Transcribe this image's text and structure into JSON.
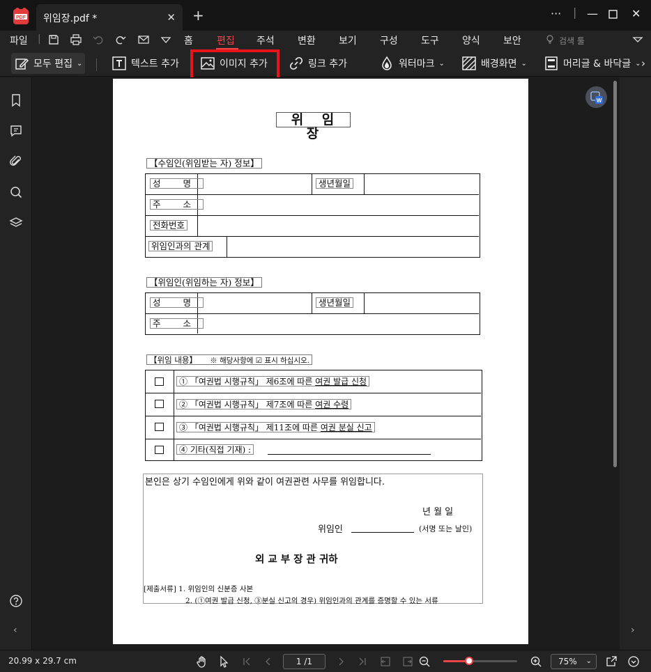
{
  "titlebar": {
    "tab_title": "위임장.pdf *",
    "close_glyph": "✕",
    "new_tab_glyph": "+",
    "more_glyph": "···",
    "minimize_glyph": "—",
    "close_window_glyph": "✕"
  },
  "menu": {
    "items": [
      "파일",
      "홈",
      "편집",
      "주석",
      "변환",
      "보기",
      "구성",
      "도구",
      "양식",
      "보안"
    ],
    "active": "편집",
    "search_placeholder": "검색 툴"
  },
  "toolbar": {
    "edit_all": "모두 편집",
    "add_text": "텍스트 추가",
    "add_image": "이미지 추가",
    "add_link": "링크 추가",
    "watermark": "워터마크",
    "background": "배경화면",
    "header_footer": "머리글 & 바닥글"
  },
  "document": {
    "title": "위 임 장",
    "sec_agent": "【수임인(위임받는 자) 정보】",
    "sec_principal": "【위임인(위임하는 자) 정보】",
    "sec_content": "【위임 내용】",
    "content_note": "※ 해당사항에 ☑ 표시 하십시오.",
    "labels": {
      "name": "성 명",
      "birth": "생년월일",
      "address": "주 소",
      "phone": "전화번호",
      "relation": "위임인과의 관계"
    },
    "options": [
      {
        "pre": "① 「여권법 시행규칙」 제6조에 따른 ",
        "u": "여권 발급 신청"
      },
      {
        "pre": "② 「여권법 시행규칙」 제7조에 따른 ",
        "u": "여권 수령"
      },
      {
        "pre": "③ 「여권법 시행규칙」 제11조에 따른 ",
        "u": "여권 분실 신고"
      },
      {
        "pre": "④ 기타(직접 기재) : ",
        "u": ""
      }
    ],
    "declaration": "본인은 상기 수임인에게 위와 같이 여권관련 사무를 위임합니다.",
    "date_line": "년    월    일",
    "delegator_label": "위임인",
    "sign_note": "(서명 또는 날인)",
    "addressee": "외 교 부 장 관    귀하",
    "attach1": "[제출서류] 1. 위임인의 신분증 사본",
    "attach2": "2. (①여권 발급 신청, ③분실 신고의 경우) 위임인과의 관계를 증명할 수 있는 서류"
  },
  "status": {
    "page_size": "20.99 x 29.7 cm",
    "page_indicator": "1 /1",
    "zoom": "75%",
    "zoom_level_fraction": 0.35
  },
  "colors": {
    "accent": "#f0454a",
    "highlight": "#e8141c"
  }
}
